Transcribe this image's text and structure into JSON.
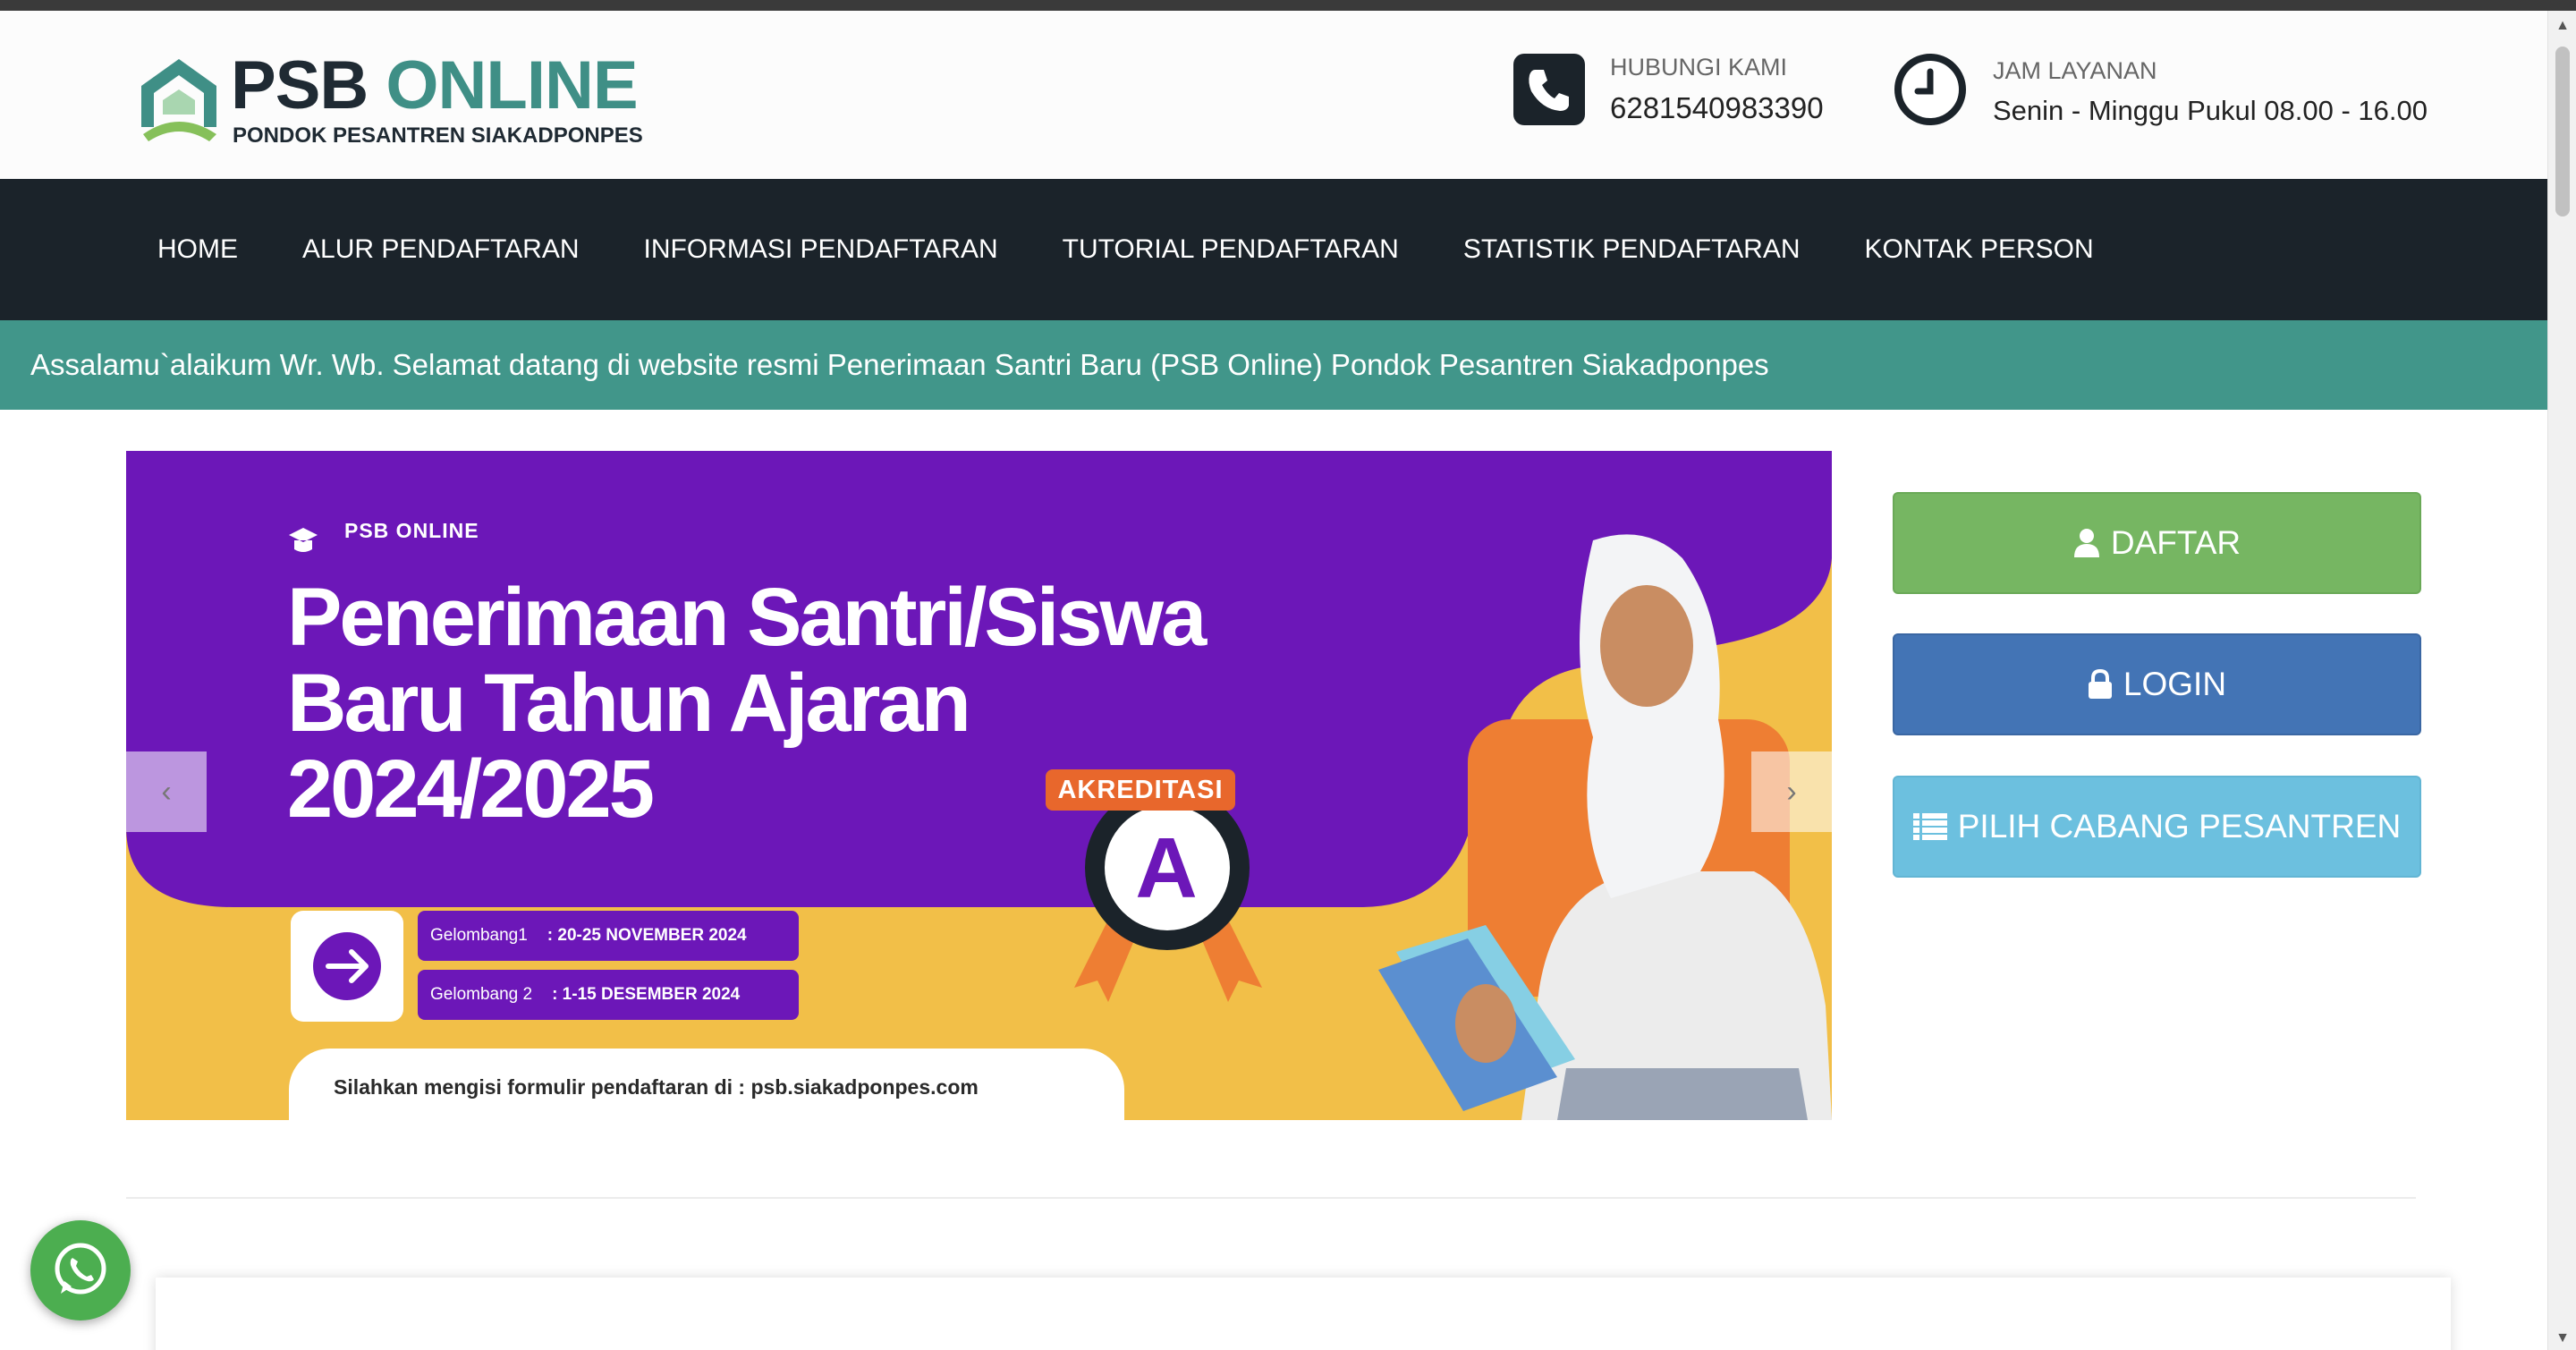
{
  "header": {
    "logo_title_1": "PSB",
    "logo_title_2": "ONLINE",
    "logo_subtitle": "PONDOK PESANTREN SIAKADPONPES",
    "contact_label": "HUBUNGI KAMI",
    "contact_value": "6281540983390",
    "hours_label": "JAM LAYANAN",
    "hours_value": "Senin - Minggu Pukul 08.00 - 16.00"
  },
  "nav": {
    "items": [
      "HOME",
      "ALUR PENDAFTARAN",
      "INFORMASI PENDAFTARAN",
      "TUTORIAL PENDAFTARAN",
      "STATISTIK PENDAFTARAN",
      "KONTAK PERSON"
    ]
  },
  "marquee": {
    "text": "Assalamu`alaikum Wr. Wb. Selamat datang di website resmi Penerimaan Santri Baru (PSB Online) Pondok Pesantren Siakadponpes"
  },
  "banner": {
    "brand": "PSB ONLINE",
    "title": "Penerimaan Santri/Siswa Baru Tahun Ajaran 2024/2025",
    "wave1_label": "Gelombang1",
    "wave1_dates": ": 20-25 NOVEMBER 2024",
    "wave2_label": "Gelombang 2",
    "wave2_dates": ": 1-15 DESEMBER 2024",
    "note": "Silahkan mengisi formulir pendaftaran di : psb.siakadponpes.com",
    "accreditation_label": "AKREDITASI",
    "accreditation_grade": "A",
    "prev_glyph": "‹",
    "next_glyph": "›"
  },
  "actions": {
    "daftar": "DAFTAR",
    "login": "LOGIN",
    "cabang": "PILIH CABANG PESANTREN"
  },
  "scrollbar": {
    "up": "▲",
    "down": "▼"
  },
  "colors": {
    "nav_bg": "#1b232a",
    "marquee_bg": "#41968a",
    "banner_purple": "#6c17b8",
    "banner_yellow": "#f2bf48",
    "daftar": "#76b662",
    "login": "#4374b5",
    "cabang": "#6cc0df",
    "whatsapp": "#4cae50"
  }
}
